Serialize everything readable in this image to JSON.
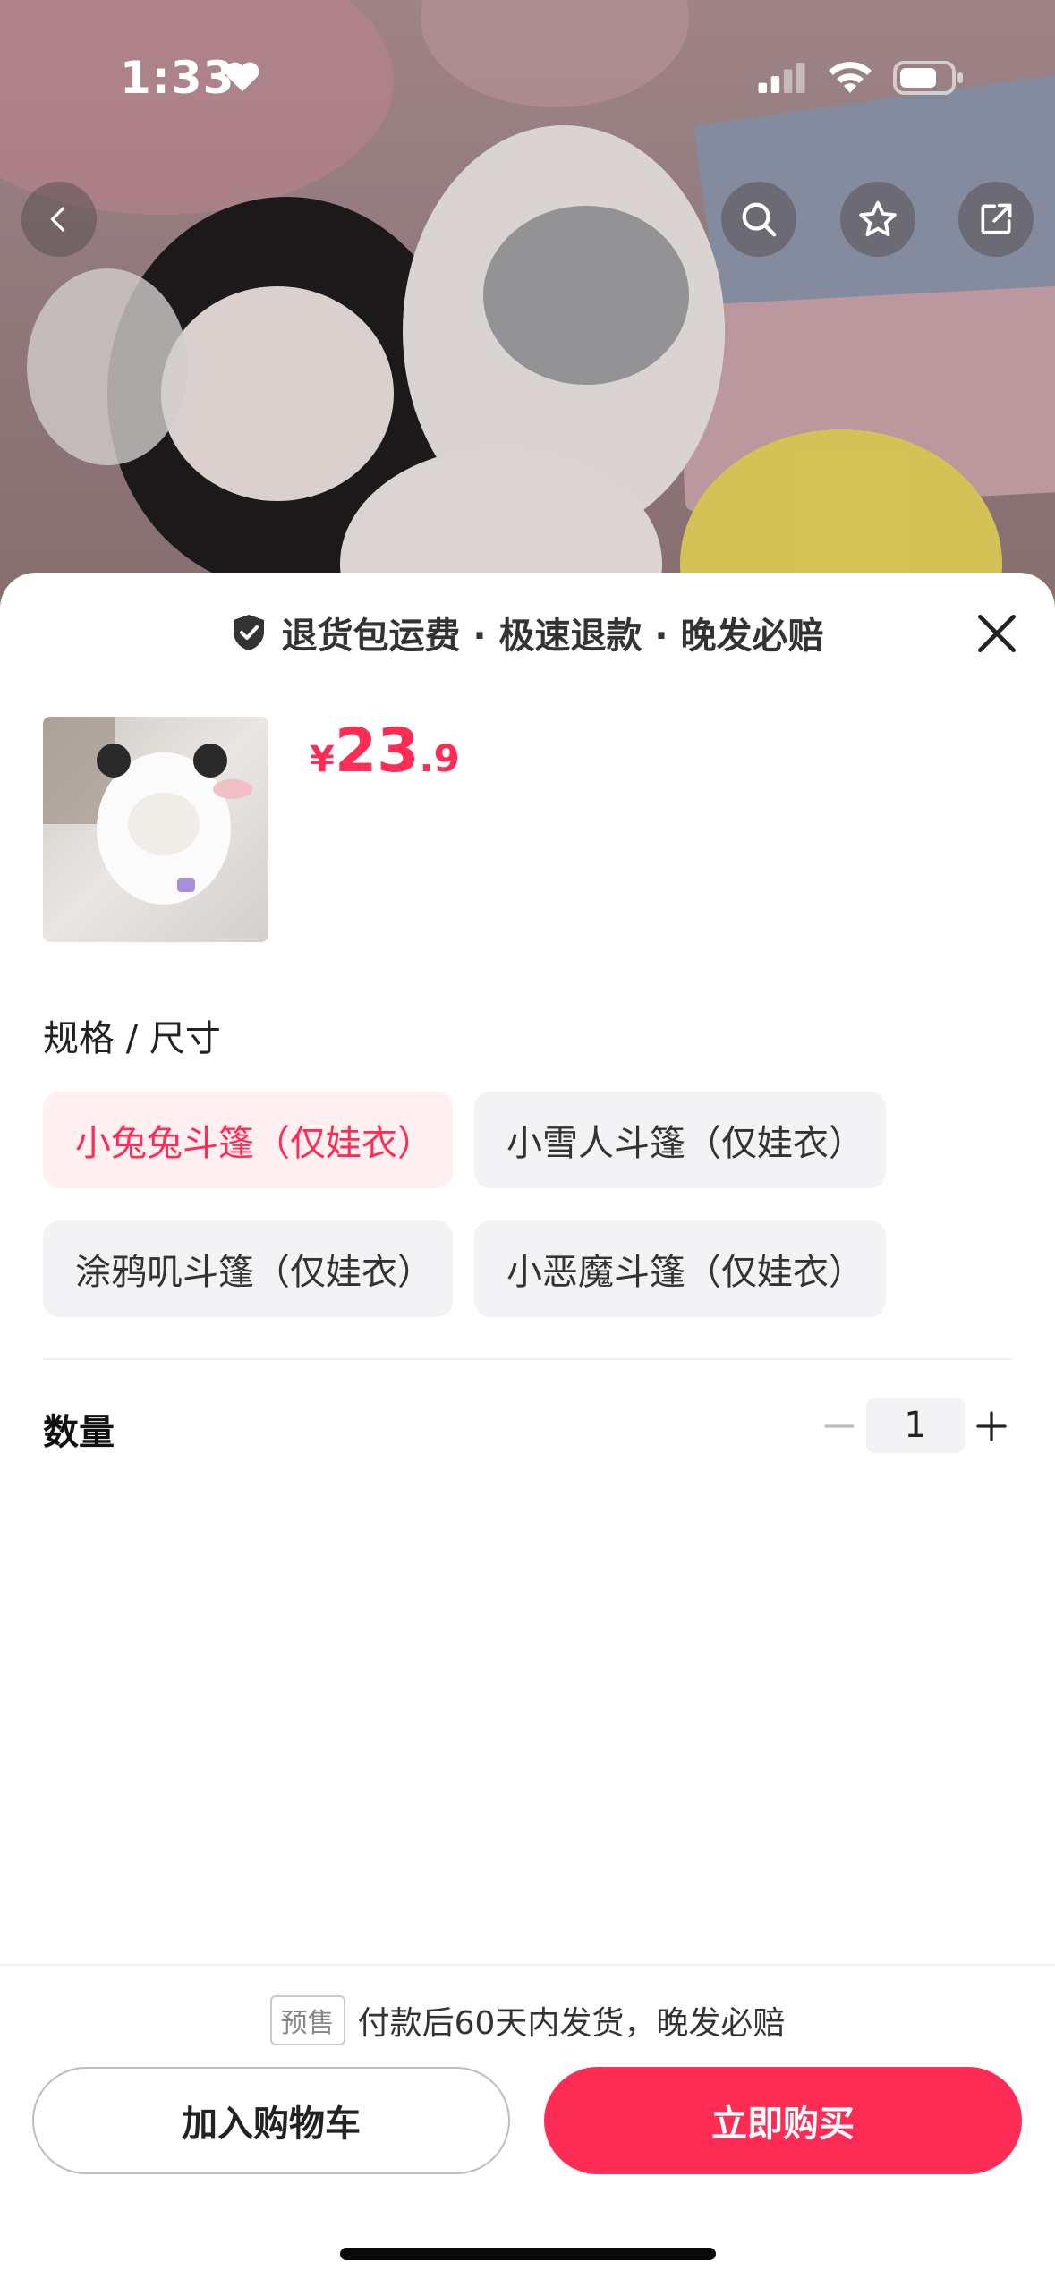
{
  "status_bar": {
    "time": "1:33"
  },
  "sheet": {
    "guarantee": "退货包运费 · 极速退款 · 晚发必赔",
    "price": {
      "symbol": "¥",
      "integer": "23",
      "decimal": ".9"
    },
    "spec_title": "规格 / 尺寸",
    "options": [
      {
        "label": "小兔兔斗篷（仅娃衣）",
        "selected": true
      },
      {
        "label": "小雪人斗篷（仅娃衣）",
        "selected": false
      },
      {
        "label": "涂鸦叽斗篷（仅娃衣）",
        "selected": false
      },
      {
        "label": "小恶魔斗篷（仅娃衣）",
        "selected": false
      }
    ],
    "quantity_label": "数量",
    "quantity_value": "1"
  },
  "footer": {
    "presale_tag": "预售",
    "presale_text": "付款后60天内发货，晚发必赔",
    "cart_button": "加入购物车",
    "buy_button": "立即购买"
  },
  "colors": {
    "accent": "#ff2d55",
    "selected_bg": "#fff0f2"
  },
  "icons": [
    "heart-icon",
    "signal-icon",
    "wifi-icon",
    "battery-icon",
    "back-icon",
    "search-icon",
    "star-icon",
    "share-icon",
    "shield-icon",
    "close-icon",
    "minus-icon",
    "plus-icon"
  ]
}
